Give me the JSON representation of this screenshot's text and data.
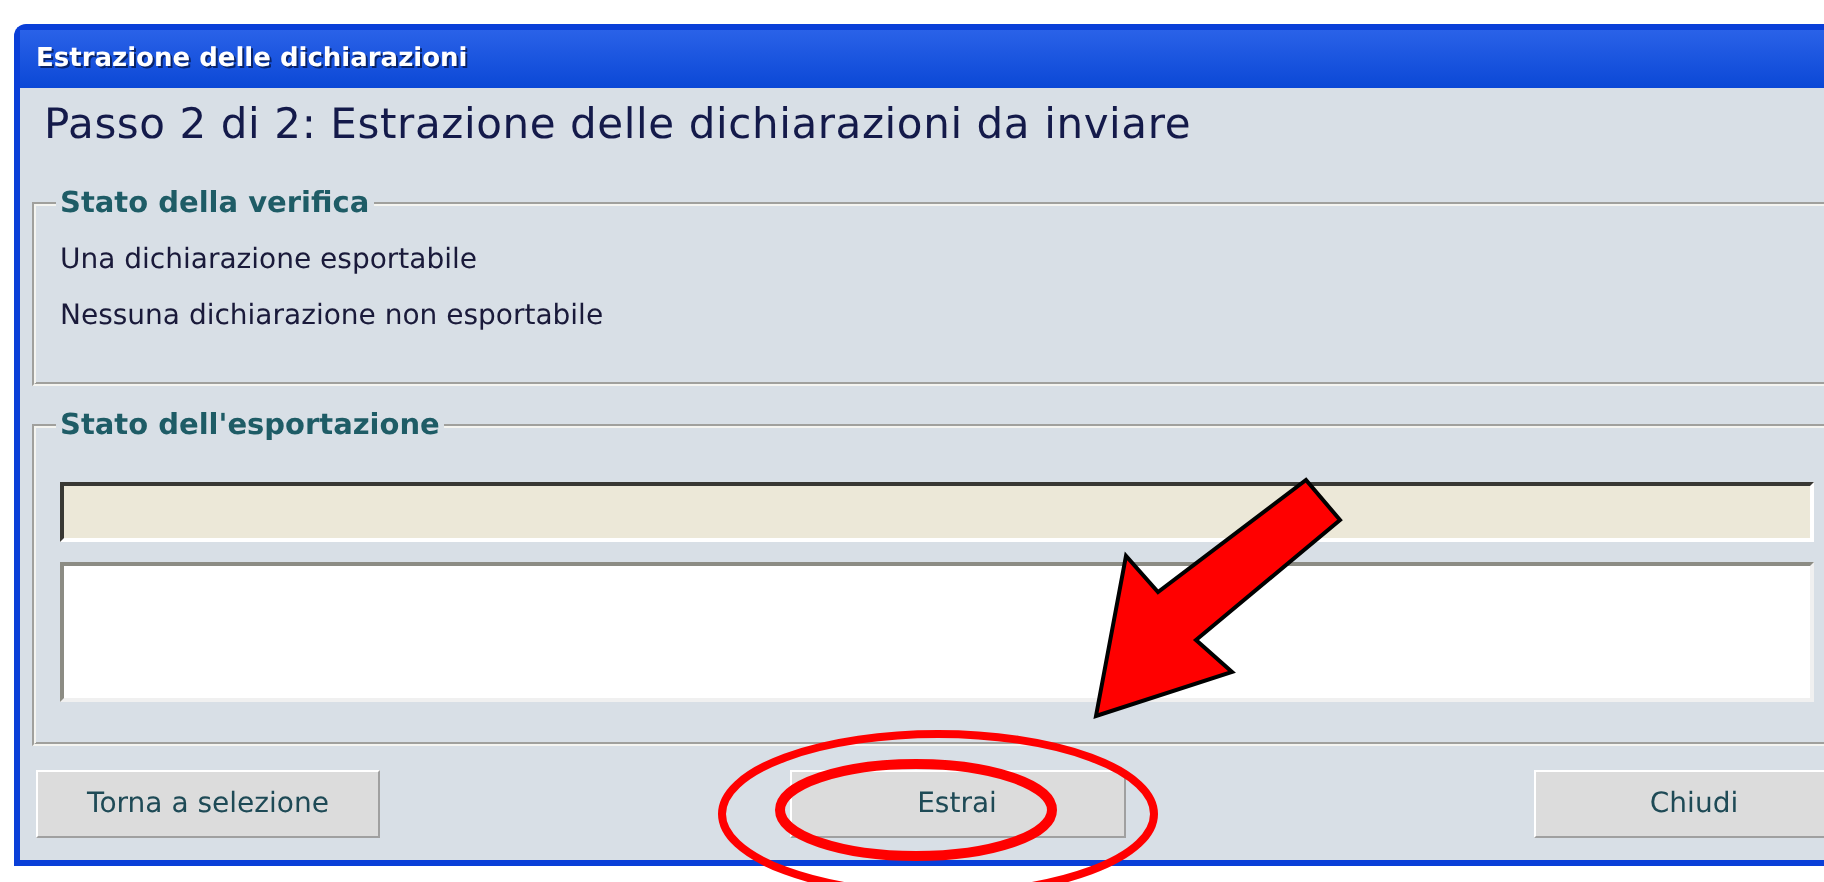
{
  "window": {
    "title": "Estrazione delle dichiarazioni"
  },
  "heading": "Passo 2 di 2: Estrazione delle dichiarazioni da inviare",
  "verification": {
    "title": "Stato della verifica",
    "lines": [
      "Una dichiarazione esportabile",
      "Nessuna dichiarazione non esportabile"
    ]
  },
  "export": {
    "title": "Stato dell'esportazione"
  },
  "buttons": [
    {
      "label": "Torna a selezione"
    },
    {
      "label": "Estrai"
    },
    {
      "label": "Chiudi"
    }
  ]
}
